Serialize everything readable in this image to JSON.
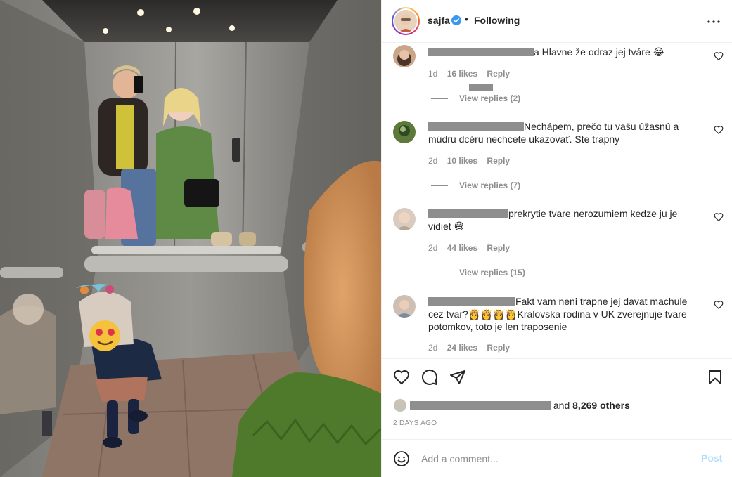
{
  "post": {
    "username": "sajfa",
    "follow_state": "Following",
    "separator": "•"
  },
  "comments": [
    {
      "text": "a Hlavne že odraz jej tváre 😂",
      "time": "1d",
      "likes": "16 likes",
      "reply": "Reply",
      "view_replies": "View replies (2)"
    },
    {
      "text": "Nechápem, prečo tu vašu úžasnú a múdru dcéru nechcete ukazovať. Ste trapny",
      "time": "2d",
      "likes": "10 likes",
      "reply": "Reply",
      "view_replies": "View replies (7)"
    },
    {
      "text": "prekrytie tvare nerozumiem kedze ju je vidiet 😅",
      "time": "2d",
      "likes": "44 likes",
      "reply": "Reply",
      "view_replies": "View replies (15)"
    },
    {
      "text": "Fakt vam neni trapne jej davat machule cez tvar?👸👸👸👸Kralovska rodina v UK zverejnuje tvare potomkov, toto je len traposenie",
      "time": "2d",
      "likes": "24 likes",
      "reply": "Reply"
    }
  ],
  "likes_summary": {
    "suffix": "and",
    "count": "8,269 others"
  },
  "timestamp": "2 DAYS AGO",
  "composer": {
    "placeholder": "Add a comment...",
    "post_label": "Post"
  },
  "colors": {
    "link": "#0095f6",
    "post_disabled": "#b2dffc",
    "muted": "#8e8e8e",
    "verified": "#3897f0"
  },
  "icons": [
    "verified-badge-icon",
    "more-options-icon",
    "heart-icon",
    "comment-icon",
    "share-icon",
    "bookmark-icon",
    "emoji-icon"
  ]
}
